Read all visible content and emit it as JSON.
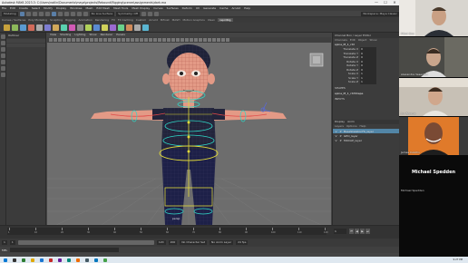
{
  "titlebar": {
    "title": "Autodesk MAYA 2023.3: C:\\Users\\rodlin\\Documents\\maya\\projects\\Rebound\\Rigging\\scenes\\assignments\\dark.ma",
    "controls": [
      "—",
      "☐",
      "✕"
    ]
  },
  "menubar": [
    "File",
    "Edit",
    "Create",
    "Select",
    "Modify",
    "Display",
    "Windows",
    "Mesh",
    "Edit Mesh",
    "Mesh Tools",
    "Mesh Display",
    "Curves",
    "Surfaces",
    "Deform",
    "UV",
    "Generate",
    "Cache",
    "Arnold",
    "Help"
  ],
  "statusline": {
    "menuset": "Modeling",
    "no_live": "No Live Surface",
    "symmetry": "Symmetry: Off",
    "workspace": "Workspace: Maya Classic"
  },
  "shelf_tabs": [
    "Curves / Surfaces",
    "Poly Modeling",
    "Sculpting",
    "Rigging",
    "Animation",
    "Rendering",
    "FX",
    "FX Caching",
    "Custom",
    "Arnold",
    "Bifrost",
    "MASH",
    "Motion Graphics",
    "XGen",
    "rapidRig"
  ],
  "shelf_active": "rapidRig",
  "shelf_icon_colors": [
    "#c8a23c",
    "#8cb85a",
    "#5a9ad1",
    "#d16a5a",
    "#aaaaaa",
    "#7d7dd1",
    "#d1a85a",
    "#5ad1b0",
    "#d15ab5",
    "#8b8b8b",
    "#b0d15a",
    "#5a8bd1",
    "#d1d15a",
    "#9a6ad1",
    "#6ad18b",
    "#d18b5a",
    "#aaaaaa",
    "#5ab5d1"
  ],
  "outliner": {
    "header": "Outliner"
  },
  "viewport": {
    "menu": [
      "View",
      "Shading",
      "Lighting",
      "Show",
      "Renderer",
      "Panels"
    ],
    "camera_label": "persp",
    "colors": {
      "skin": "#e39a86",
      "wire": "#b0584a",
      "shirt": "#22243a",
      "pants": "#1d2048",
      "control": "#2fd8c7",
      "joint": "#e0d83a",
      "grid": "#7a7a7a"
    }
  },
  "channelbox": {
    "tabs": [
      "Channel Box / Layer Editor"
    ],
    "sub": [
      "Channels",
      "Edit",
      "Object",
      "Show"
    ],
    "object": "spine_M_1_ctrl",
    "attributes": [
      {
        "name": "Translate X",
        "value": "0"
      },
      {
        "name": "Translate Y",
        "value": "0"
      },
      {
        "name": "Translate Z",
        "value": "0"
      },
      {
        "name": "Rotate X",
        "value": "0"
      },
      {
        "name": "Rotate Y",
        "value": "0"
      },
      {
        "name": "Rotate Z",
        "value": "0"
      },
      {
        "name": "Scale X",
        "value": "1"
      },
      {
        "name": "Scale Y",
        "value": "1"
      },
      {
        "name": "Scale Z",
        "value": "1"
      }
    ],
    "shapes_label": "SHAPES",
    "shape_name": "spine_M_1_ctrlShape",
    "inputs_label": "INPUTS",
    "layers_tabs": [
      "Display",
      "Anim"
    ],
    "layers_menu": [
      "Layers",
      "Options",
      "Help"
    ],
    "layers": [
      {
        "name": "BaseSkeletonFK_layer",
        "selected": true
      },
      {
        "name": "GEO_layer",
        "selected": false
      },
      {
        "name": "MOCAP_layer",
        "selected": false
      }
    ]
  },
  "timeslider": {
    "ticks": [
      "1",
      "10",
      "20",
      "30",
      "40",
      "50",
      "60",
      "70",
      "80",
      "90",
      "100",
      "110",
      "120"
    ],
    "current_frame": "1",
    "controls": [
      "⏮",
      "◀",
      "▶",
      "⏭"
    ]
  },
  "rangeslider": {
    "start": "1",
    "inner_start": "1",
    "inner_end": "120",
    "end": "200",
    "char_set": "No Character Set",
    "anim_layer": "No Anim Layer",
    "fps": "24 fps"
  },
  "cmdline": {
    "label": "MEL"
  },
  "taskbar": {
    "icon_colors": [
      "#0078d4",
      "#333333",
      "#2d7d32",
      "#e0a800",
      "#1976d2",
      "#c62828",
      "#6a1b9a",
      "#00897b",
      "#ef6c00",
      "#455a64",
      "#0277bd",
      "#43a047"
    ],
    "clock": "9:27 PM"
  },
  "videocall": {
    "participants": [
      {
        "name": "Mikel Gier",
        "bg": "#d8d5cf"
      },
      {
        "name": "Alexandre Vesentini",
        "bg": "#4a4a46"
      },
      {
        "name": "Jon Bourne",
        "bg": "#c7c0b5"
      },
      {
        "name": "James Calvillo",
        "bg": "#3a3a3a"
      }
    ],
    "speaker": "Michael Spedden",
    "speaker_label": "Michael Spedden"
  }
}
